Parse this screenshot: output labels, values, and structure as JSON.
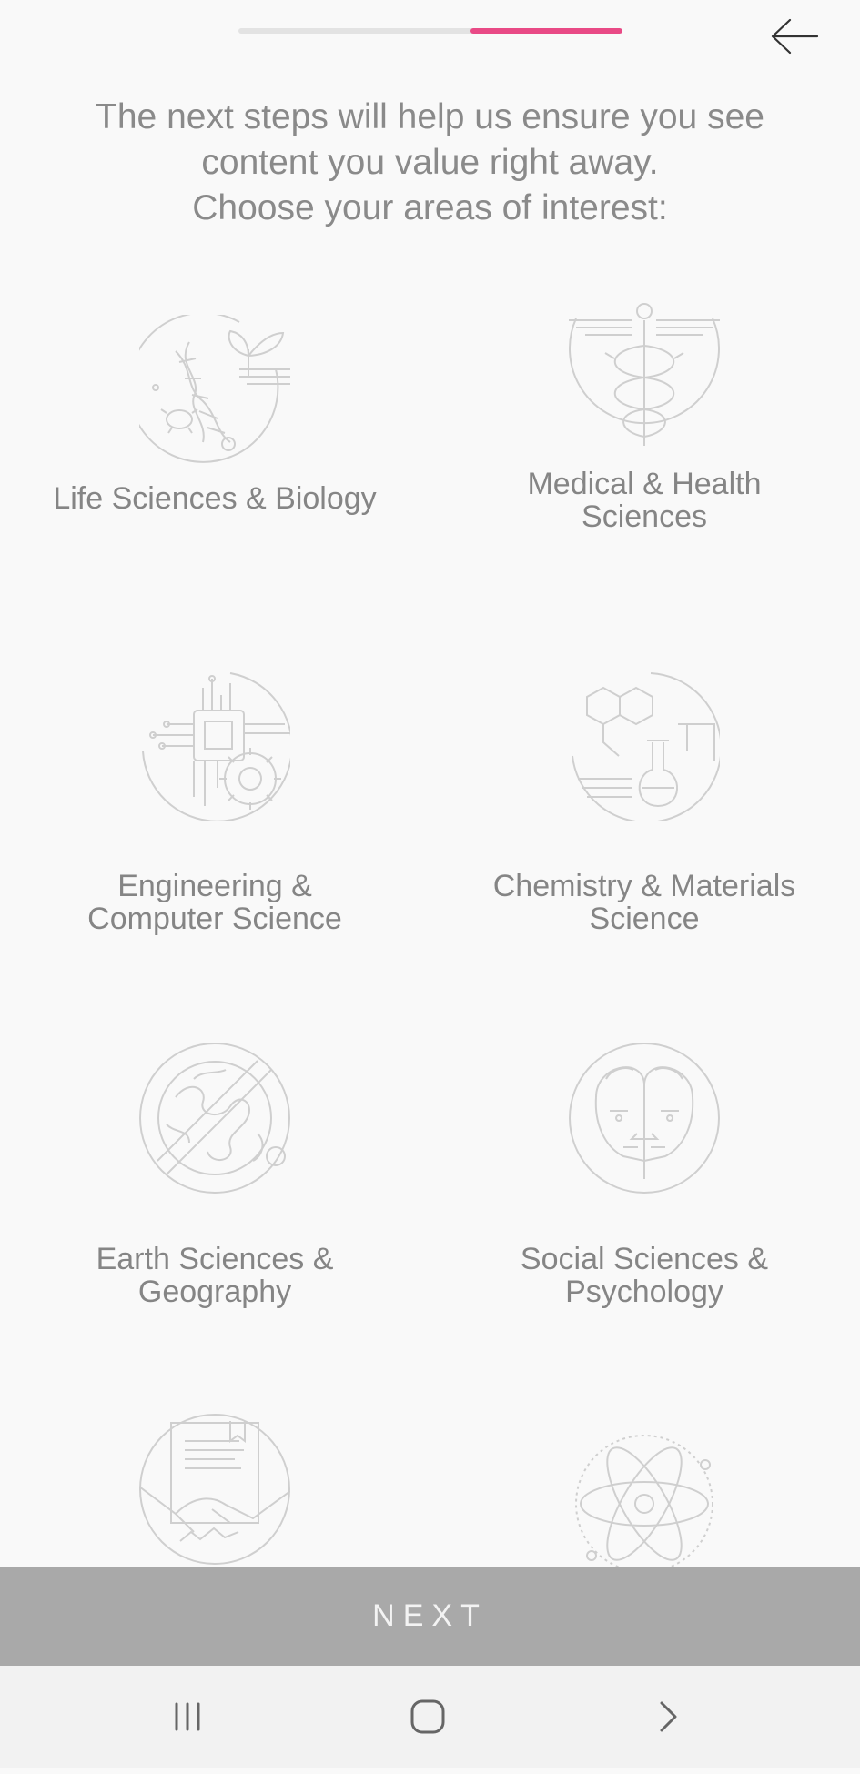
{
  "progress": {
    "fraction_start": 0.605,
    "fraction_end": 1.0
  },
  "header": {
    "back_icon": "arrow-left-icon"
  },
  "intro": {
    "line1": "The next steps will help us ensure you see",
    "line2": "content you value right away.",
    "line3": "Choose your areas of interest:"
  },
  "topics": [
    {
      "line1": "Life Sciences & Biology",
      "line2": "",
      "icon": "dna-plant-icon"
    },
    {
      "line1": "Medical & Health",
      "line2": "Sciences",
      "icon": "caduceus-icon"
    },
    {
      "line1": "Engineering &",
      "line2": "Computer Science",
      "icon": "circuit-gear-icon"
    },
    {
      "line1": "Chemistry & Materials",
      "line2": "Science",
      "icon": "flask-molecule-icon"
    },
    {
      "line1": "Earth Sciences &",
      "line2": "Geography",
      "icon": "globe-icon"
    },
    {
      "line1": "Social Sciences &",
      "line2": "Psychology",
      "icon": "faces-icon"
    },
    {
      "line1": "",
      "line2": "",
      "icon": "handshake-document-icon"
    },
    {
      "line1": "",
      "line2": "",
      "icon": "atom-icon"
    }
  ],
  "next_label": "NEXT",
  "navbar": {
    "recent": "recent-apps-icon",
    "home": "home-icon",
    "back": "chevron-right-icon"
  },
  "colors": {
    "accent": "#e94a86",
    "button": "#a9a9a9",
    "icon": "#cfcfcf"
  }
}
